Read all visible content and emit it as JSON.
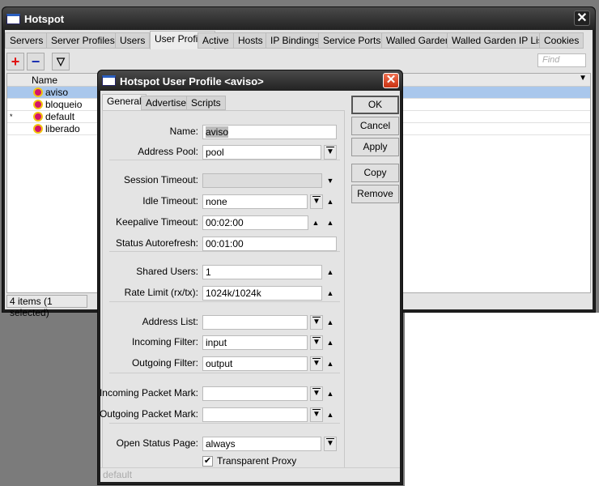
{
  "main": {
    "title": "Hotspot",
    "tabs": [
      "Servers",
      "Server Profiles",
      "Users",
      "User Profiles",
      "Active",
      "Hosts",
      "IP Bindings",
      "Service Ports",
      "Walled Garden",
      "Walled Garden IP List",
      "Cookies"
    ],
    "active_tab": 3,
    "find_placeholder": "Find",
    "column_name": "Name",
    "rows": [
      {
        "flag": "",
        "name": "aviso",
        "selected": true
      },
      {
        "flag": "",
        "name": "bloqueio"
      },
      {
        "flag": "*",
        "name": "default"
      },
      {
        "flag": "",
        "name": "liberado"
      }
    ],
    "status": "4 items (1 selected)"
  },
  "dialog": {
    "title": "Hotspot User Profile <aviso>",
    "tabs": [
      "General",
      "Advertise",
      "Scripts"
    ],
    "buttons": [
      "OK",
      "Cancel",
      "Apply",
      "Copy",
      "Remove"
    ],
    "fields": [
      {
        "label": "Name:",
        "value": "aviso"
      },
      {
        "label": "Address Pool:",
        "value": "pool"
      },
      {
        "label": "Session Timeout:",
        "value": ""
      },
      {
        "label": "Idle Timeout:",
        "value": "none"
      },
      {
        "label": "Keepalive Timeout:",
        "value": "00:02:00"
      },
      {
        "label": "Status Autorefresh:",
        "value": "00:01:00"
      },
      {
        "label": "Shared Users:",
        "value": "1"
      },
      {
        "label": "Rate Limit (rx/tx):",
        "value": "1024k/1024k"
      },
      {
        "label": "Address List:",
        "value": ""
      },
      {
        "label": "Incoming Filter:",
        "value": "input"
      },
      {
        "label": "Outgoing Filter:",
        "value": "output"
      },
      {
        "label": "Incoming Packet Mark:",
        "value": ""
      },
      {
        "label": "Outgoing Packet Mark:",
        "value": ""
      },
      {
        "label": "Open Status Page:",
        "value": "always"
      }
    ],
    "transparent_proxy": {
      "label": "Transparent Proxy",
      "checked": true
    },
    "status": "default"
  }
}
